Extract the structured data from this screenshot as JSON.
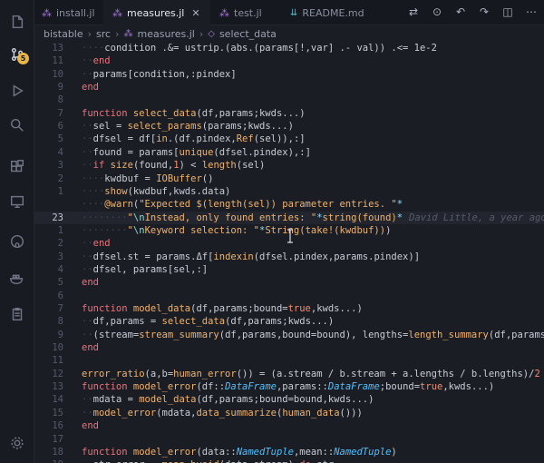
{
  "tabs": [
    {
      "name": "install.jl",
      "active": false
    },
    {
      "name": "measures.jl",
      "active": true
    },
    {
      "name": "test.jl",
      "active": false
    },
    {
      "name": "README.md",
      "active": false
    }
  ],
  "breadcrumb": [
    "bistable",
    "src",
    "measures.jl",
    "select_data"
  ],
  "scm_badge": "5",
  "icons": {
    "explorer": "files-icon",
    "scm": "source-control-icon",
    "debug": "run-debug-icon",
    "extensions": "extensions-icon",
    "remote": "remote-explorer-icon",
    "github": "github-icon",
    "docker": "docker-icon",
    "notes": "clipboard-icon",
    "settings": "gear-icon"
  },
  "blame": "David Little, a year ago",
  "lines": [
    {
      "n": "13",
      "html": "<span class='ws'>····</span><span class='pl'>condition .&amp;= ustrip.(abs.(params[!,var] .- val)) .&lt;= 1e-2</span>"
    },
    {
      "n": "11",
      "html": "<span class='ws'>··</span><span class='kw'>end</span>"
    },
    {
      "n": "10",
      "html": "<span class='ws'>··</span><span class='pl'>params[condition,:pindex]</span>"
    },
    {
      "n": "9",
      "html": "<span class='kw'>end</span>"
    },
    {
      "n": "8",
      "html": ""
    },
    {
      "n": "7",
      "html": "<span class='kw'>function</span> <span class='fn'>select_data</span><span class='pl'>(df,params;kwds...)</span>"
    },
    {
      "n": "6",
      "html": "<span class='ws'>··</span><span class='pl'>sel = </span><span class='fn'>select_params</span><span class='pl'>(params;kwds...)</span>"
    },
    {
      "n": "5",
      "html": "<span class='ws'>··</span><span class='pl'>dfsel = df[</span><span class='fn'>in</span><span class='pl'>.(df.pindex,</span><span class='fn'>Ref</span><span class='pl'>(sel)),:]</span>"
    },
    {
      "n": "4",
      "html": "<span class='ws'>··</span><span class='pl'>found = params[</span><span class='fn'>unique</span><span class='pl'>(dfsel.pindex),:]</span>"
    },
    {
      "n": "3",
      "html": "<span class='ws'>··</span><span class='kw'>if</span> <span class='fn'>size</span><span class='pl'>(found,</span><span class='num'>1</span><span class='pl'>) &lt; </span><span class='fn'>length</span><span class='pl'>(sel)</span>"
    },
    {
      "n": "2",
      "html": "<span class='ws'>····</span><span class='pl'>kwdbuf = </span><span class='fn'>IOBuffer</span><span class='pl'>()</span>"
    },
    {
      "n": "1",
      "html": "<span class='ws'>····</span><span class='fn'>show</span><span class='pl'>(kwdbuf,kwds.data)</span>"
    },
    {
      "n": "",
      "html": "<span class='ws'>····</span><span class='mac'>@warn</span><span class='pl'>(</span><span class='str'>\"Expected $(length(sel)) parameter entries. \"</span><span class='op'>*</span>"
    },
    {
      "n": "23",
      "html": "<span class='ws'>········</span><span class='str'>\"</span><span class='esc'>\\n</span><span class='str'>Instead, only found entries: \"</span><span class='op'>*</span><span class='str'>string(found)</span><span class='op'>*</span>",
      "current": true
    },
    {
      "n": "1",
      "html": "<span class='ws'>········</span><span class='str'>\"</span><span class='esc'>\\n</span><span class='str'>Keyword selection: \"</span><span class='op'>*</span><span class='str'>String(take!(kwdbuf))</span><span class='pl'>)</span>"
    },
    {
      "n": "2",
      "html": "<span class='ws'>··</span><span class='kw'>end</span>"
    },
    {
      "n": "3",
      "html": "<span class='ws'>··</span><span class='pl'>dfsel.st = params.Δf[</span><span class='fn'>indexin</span><span class='pl'>(dfsel.pindex,params.pindex)]</span>"
    },
    {
      "n": "4",
      "html": "<span class='ws'>··</span><span class='pl'>dfsel, params[sel,:]</span>"
    },
    {
      "n": "5",
      "html": "<span class='kw'>end</span>"
    },
    {
      "n": "6",
      "html": ""
    },
    {
      "n": "7",
      "html": "<span class='kw'>function</span> <span class='fn'>model_data</span><span class='pl'>(df,params;bound=</span><span class='num'>true</span><span class='pl'>,kwds...)</span>"
    },
    {
      "n": "8",
      "html": "<span class='ws'>··</span><span class='pl'>df,params = </span><span class='fn'>select_data</span><span class='pl'>(df,params;kwds...)</span>"
    },
    {
      "n": "9",
      "html": "<span class='ws'>··</span><span class='pl'>(stream=</span><span class='fn'>stream_summary</span><span class='pl'>(df,params,bound=bound), lengths=</span><span class='fn'>length_summary</span><span class='pl'>(df,params))</span>"
    },
    {
      "n": "10",
      "html": "<span class='kw'>end</span>"
    },
    {
      "n": "11",
      "html": ""
    },
    {
      "n": "12",
      "html": "<span class='fn'>error_ratio</span><span class='pl'>(a,b=</span><span class='fn'>human_error</span><span class='pl'>()) = (a.stream / b.stream + a.lengths / b.lengths)/</span><span class='num'>2</span>"
    },
    {
      "n": "13",
      "html": "<span class='kw'>function</span> <span class='fn'>model_error</span><span class='pl'>(df::</span><span class='typ'>DataFrame</span><span class='pl'>,params::</span><span class='typ'>DataFrame</span><span class='pl'>;bound=</span><span class='num'>true</span><span class='pl'>,kwds...)</span>"
    },
    {
      "n": "14",
      "html": "<span class='ws'>··</span><span class='pl'>mdata = </span><span class='fn'>model_data</span><span class='pl'>(df,params;bound=bound,kwds...)</span>"
    },
    {
      "n": "15",
      "html": "<span class='ws'>··</span><span class='fn'>model_error</span><span class='pl'>(mdata,</span><span class='fn'>data_summarize</span><span class='pl'>(</span><span class='fn'>human_data</span><span class='pl'>()))</span>"
    },
    {
      "n": "16",
      "html": "<span class='kw'>end</span>"
    },
    {
      "n": "17",
      "html": ""
    },
    {
      "n": "18",
      "html": "<span class='kw'>function</span> <span class='fn'>model_error</span><span class='pl'>(data::</span><span class='typ'>NamedTuple</span><span class='pl'>,mean::</span><span class='typ'>NamedTuple</span><span class='pl'>)</span>"
    },
    {
      "n": "19",
      "html": "<span class='ws'>··</span><span class='pl'>str_error = </span><span class='fn'>mean_bysid</span><span class='pl'>(data.stream) </span><span class='kw'>do</span><span class='pl'> str</span>"
    }
  ]
}
